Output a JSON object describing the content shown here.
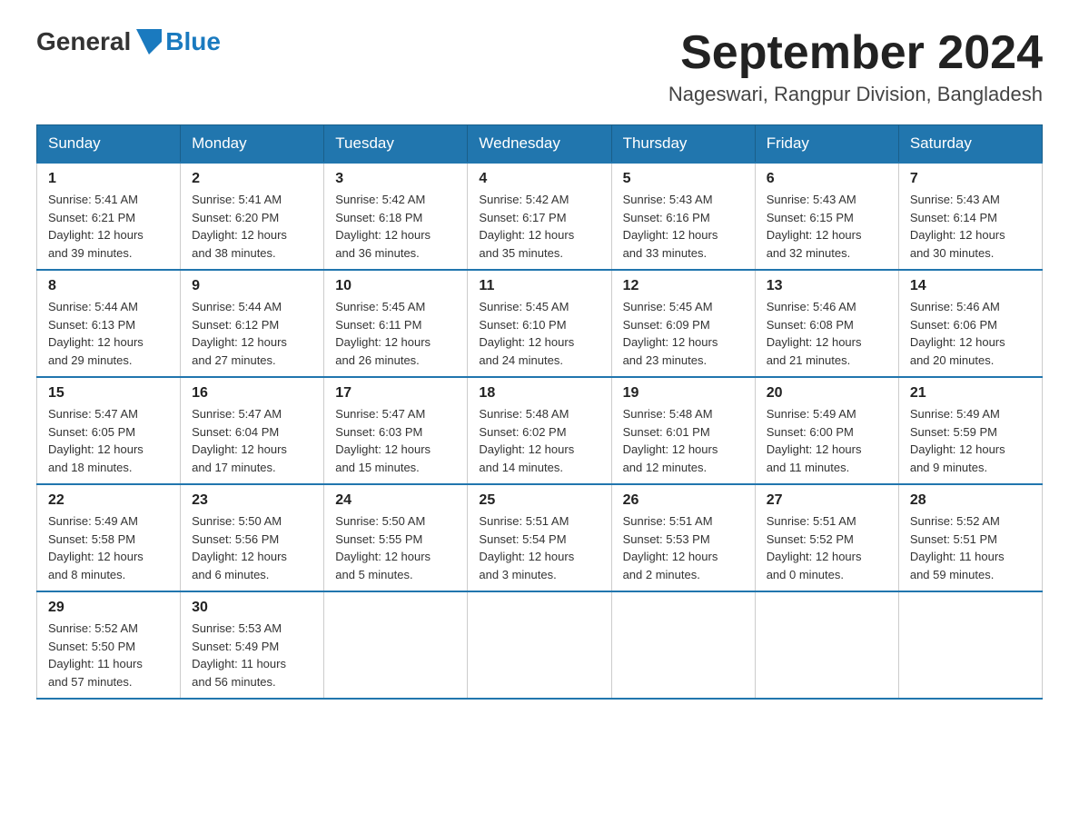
{
  "header": {
    "logo_general": "General",
    "logo_blue": "Blue",
    "month_title": "September 2024",
    "location": "Nageswari, Rangpur Division, Bangladesh"
  },
  "days_of_week": [
    "Sunday",
    "Monday",
    "Tuesday",
    "Wednesday",
    "Thursday",
    "Friday",
    "Saturday"
  ],
  "weeks": [
    [
      {
        "day": "1",
        "sunrise": "5:41 AM",
        "sunset": "6:21 PM",
        "daylight": "12 hours and 39 minutes."
      },
      {
        "day": "2",
        "sunrise": "5:41 AM",
        "sunset": "6:20 PM",
        "daylight": "12 hours and 38 minutes."
      },
      {
        "day": "3",
        "sunrise": "5:42 AM",
        "sunset": "6:18 PM",
        "daylight": "12 hours and 36 minutes."
      },
      {
        "day": "4",
        "sunrise": "5:42 AM",
        "sunset": "6:17 PM",
        "daylight": "12 hours and 35 minutes."
      },
      {
        "day": "5",
        "sunrise": "5:43 AM",
        "sunset": "6:16 PM",
        "daylight": "12 hours and 33 minutes."
      },
      {
        "day": "6",
        "sunrise": "5:43 AM",
        "sunset": "6:15 PM",
        "daylight": "12 hours and 32 minutes."
      },
      {
        "day": "7",
        "sunrise": "5:43 AM",
        "sunset": "6:14 PM",
        "daylight": "12 hours and 30 minutes."
      }
    ],
    [
      {
        "day": "8",
        "sunrise": "5:44 AM",
        "sunset": "6:13 PM",
        "daylight": "12 hours and 29 minutes."
      },
      {
        "day": "9",
        "sunrise": "5:44 AM",
        "sunset": "6:12 PM",
        "daylight": "12 hours and 27 minutes."
      },
      {
        "day": "10",
        "sunrise": "5:45 AM",
        "sunset": "6:11 PM",
        "daylight": "12 hours and 26 minutes."
      },
      {
        "day": "11",
        "sunrise": "5:45 AM",
        "sunset": "6:10 PM",
        "daylight": "12 hours and 24 minutes."
      },
      {
        "day": "12",
        "sunrise": "5:45 AM",
        "sunset": "6:09 PM",
        "daylight": "12 hours and 23 minutes."
      },
      {
        "day": "13",
        "sunrise": "5:46 AM",
        "sunset": "6:08 PM",
        "daylight": "12 hours and 21 minutes."
      },
      {
        "day": "14",
        "sunrise": "5:46 AM",
        "sunset": "6:06 PM",
        "daylight": "12 hours and 20 minutes."
      }
    ],
    [
      {
        "day": "15",
        "sunrise": "5:47 AM",
        "sunset": "6:05 PM",
        "daylight": "12 hours and 18 minutes."
      },
      {
        "day": "16",
        "sunrise": "5:47 AM",
        "sunset": "6:04 PM",
        "daylight": "12 hours and 17 minutes."
      },
      {
        "day": "17",
        "sunrise": "5:47 AM",
        "sunset": "6:03 PM",
        "daylight": "12 hours and 15 minutes."
      },
      {
        "day": "18",
        "sunrise": "5:48 AM",
        "sunset": "6:02 PM",
        "daylight": "12 hours and 14 minutes."
      },
      {
        "day": "19",
        "sunrise": "5:48 AM",
        "sunset": "6:01 PM",
        "daylight": "12 hours and 12 minutes."
      },
      {
        "day": "20",
        "sunrise": "5:49 AM",
        "sunset": "6:00 PM",
        "daylight": "12 hours and 11 minutes."
      },
      {
        "day": "21",
        "sunrise": "5:49 AM",
        "sunset": "5:59 PM",
        "daylight": "12 hours and 9 minutes."
      }
    ],
    [
      {
        "day": "22",
        "sunrise": "5:49 AM",
        "sunset": "5:58 PM",
        "daylight": "12 hours and 8 minutes."
      },
      {
        "day": "23",
        "sunrise": "5:50 AM",
        "sunset": "5:56 PM",
        "daylight": "12 hours and 6 minutes."
      },
      {
        "day": "24",
        "sunrise": "5:50 AM",
        "sunset": "5:55 PM",
        "daylight": "12 hours and 5 minutes."
      },
      {
        "day": "25",
        "sunrise": "5:51 AM",
        "sunset": "5:54 PM",
        "daylight": "12 hours and 3 minutes."
      },
      {
        "day": "26",
        "sunrise": "5:51 AM",
        "sunset": "5:53 PM",
        "daylight": "12 hours and 2 minutes."
      },
      {
        "day": "27",
        "sunrise": "5:51 AM",
        "sunset": "5:52 PM",
        "daylight": "12 hours and 0 minutes."
      },
      {
        "day": "28",
        "sunrise": "5:52 AM",
        "sunset": "5:51 PM",
        "daylight": "11 hours and 59 minutes."
      }
    ],
    [
      {
        "day": "29",
        "sunrise": "5:52 AM",
        "sunset": "5:50 PM",
        "daylight": "11 hours and 57 minutes."
      },
      {
        "day": "30",
        "sunrise": "5:53 AM",
        "sunset": "5:49 PM",
        "daylight": "11 hours and 56 minutes."
      },
      null,
      null,
      null,
      null,
      null
    ]
  ],
  "labels": {
    "sunrise": "Sunrise:",
    "sunset": "Sunset:",
    "daylight": "Daylight:"
  }
}
